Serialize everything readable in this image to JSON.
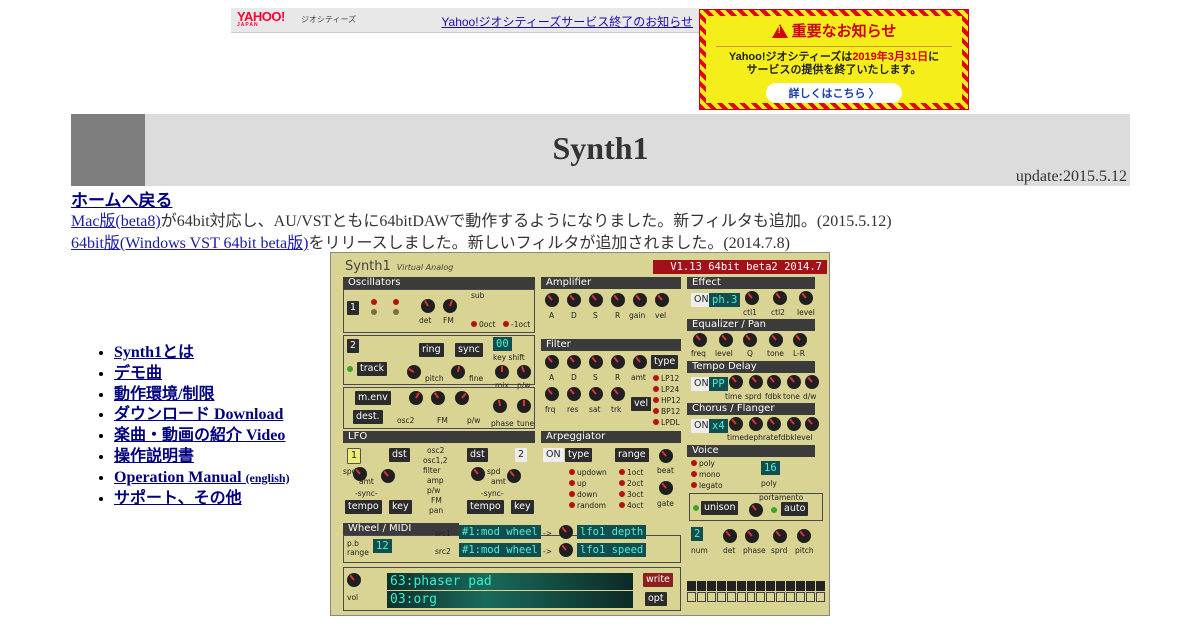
{
  "banner": {
    "logo_text": "YAHOO!",
    "logo_small": "JAPAN",
    "logo_sub": "ジオシティーズ",
    "end_link": "Yahoo!ジオシティーズサービス終了のお知らせ"
  },
  "notice": {
    "title": "重要なお知らせ",
    "line1a": "Yahoo!ジオシティーズは",
    "line1b": "2019年3月31日",
    "line1c": "に",
    "line2": "サービスの提供を終了いたします。",
    "button": "詳しくはこちら 〉"
  },
  "header": {
    "title": "Synth1",
    "update": "update:2015.5.12"
  },
  "home_link": "ホームへ戻る",
  "news": [
    {
      "link": "Mac版(beta8)",
      "text": "が64bit対応し、AU/VSTともに64bitDAWで動作するようになりました。新フィルタも追加。(2015.5.12)"
    },
    {
      "link": "64bit版(Windows VST 64bit beta版)",
      "text": "をリリースしました。新しいフィルタが追加されました。(2014.7.8)"
    }
  ],
  "nav": [
    {
      "label": "Synth1とは"
    },
    {
      "label": "デモ曲"
    },
    {
      "label": "動作環境/制限"
    },
    {
      "label": "ダウンロード Download"
    },
    {
      "label": "楽曲・動画の紹介 Video"
    },
    {
      "label": "操作説明書"
    },
    {
      "label": "Operation Manual",
      "small": "(english)"
    },
    {
      "label": "サポート、その他"
    }
  ],
  "synth": {
    "brand": "Synth1",
    "brand_sub": "Virtual Analog",
    "version": "V1.13 64bit beta2 2014.7",
    "sections": {
      "oscillators": "Oscillators",
      "amplifier": "Amplifier",
      "filter": "Filter",
      "lfo": "LFO",
      "arpeggiator": "Arpeggiator",
      "wheel": "Wheel / MIDI",
      "effect": "Effect",
      "equalizer": "Equalizer / Pan",
      "tempo_delay": "Tempo Delay",
      "chorus": "Chorus / Flanger",
      "voice": "Voice"
    },
    "labels": {
      "sub": "sub",
      "det": "det",
      "fm": "FM",
      "oct0": "0oct",
      "oct1": "-1oct",
      "ring": "ring",
      "sync": "sync",
      "track": "track",
      "pitch": "pitch",
      "fine": "fine",
      "key_shift": "key shift",
      "key_val": "00",
      "mix": "mix",
      "pw": "p/w",
      "menv": "m.env",
      "dest": "dest.",
      "osc2": "osc2",
      "fm2": "FM",
      "pw2": "p/w",
      "amt": "amt",
      "phase": "phase",
      "tune": "tune",
      "a": "A",
      "d": "D",
      "s": "S",
      "r": "R",
      "gain": "gain",
      "vel": "vel",
      "type": "type",
      "frq": "frq",
      "res": "res",
      "sat": "sat",
      "trk": "trk",
      "lp12": "LP12",
      "lp24": "LP24",
      "hp12": "HP12",
      "bp12": "BP12",
      "lpdl": "LPDL",
      "on": "ON",
      "ph3": "ph.3",
      "ctl1": "ctl1",
      "ctl2": "ctl2",
      "level": "level",
      "freq": "freq",
      "q": "Q",
      "tone": "tone",
      "lr": "L-R",
      "pp": "PP",
      "time": "time",
      "sprd": "sprd",
      "fdbk": "fdbk",
      "tone_w": "tone",
      "dw": "d/w",
      "x4": "x4",
      "dephrate": "timedephratefdbklevel",
      "poly": "poly",
      "mono": "mono",
      "legato": "legato",
      "poly_num": "16",
      "poly_lbl": "poly",
      "portamento": "portamento",
      "unison": "unison",
      "auto": "auto",
      "num": "num",
      "num_val": "2",
      "det2": "det",
      "phase2": "phase",
      "sprd2": "sprd",
      "pitch2": "pitch",
      "lfo1": "1",
      "lfo2": "2",
      "dst": "dst",
      "osc2m": "osc2",
      "osc12": "osc1,2",
      "filter": "filter",
      "amp": "amp",
      "pw3": "p/w",
      "fm3": "FM",
      "pan": "pan",
      "spd": "spd",
      "amt2": "amt",
      "sync2": "-sync-",
      "tempo": "tempo",
      "key": "key",
      "arp_on": "ON",
      "arp_type": "type",
      "range": "range",
      "updown": "updown",
      "up": "up",
      "down": "down",
      "random": "random",
      "oct1b": "1oct",
      "oct2": "2oct",
      "oct3": "3oct",
      "oct4": "4oct",
      "beat": "beat",
      "gate": "gate",
      "pb_range": "p.b range",
      "pb_val": "12",
      "src1": "src1",
      "src2": "src2",
      "mod1": "#1:mod wheel",
      "mod2": "#1:mod wheel",
      "dst1": "lfo1 depth",
      "dst2": "lfo1 speed",
      "arrow": "->",
      "vol": "vol",
      "preset": "63:phaser pad",
      "bank": "03:org",
      "write": "write",
      "opt": "opt"
    }
  }
}
